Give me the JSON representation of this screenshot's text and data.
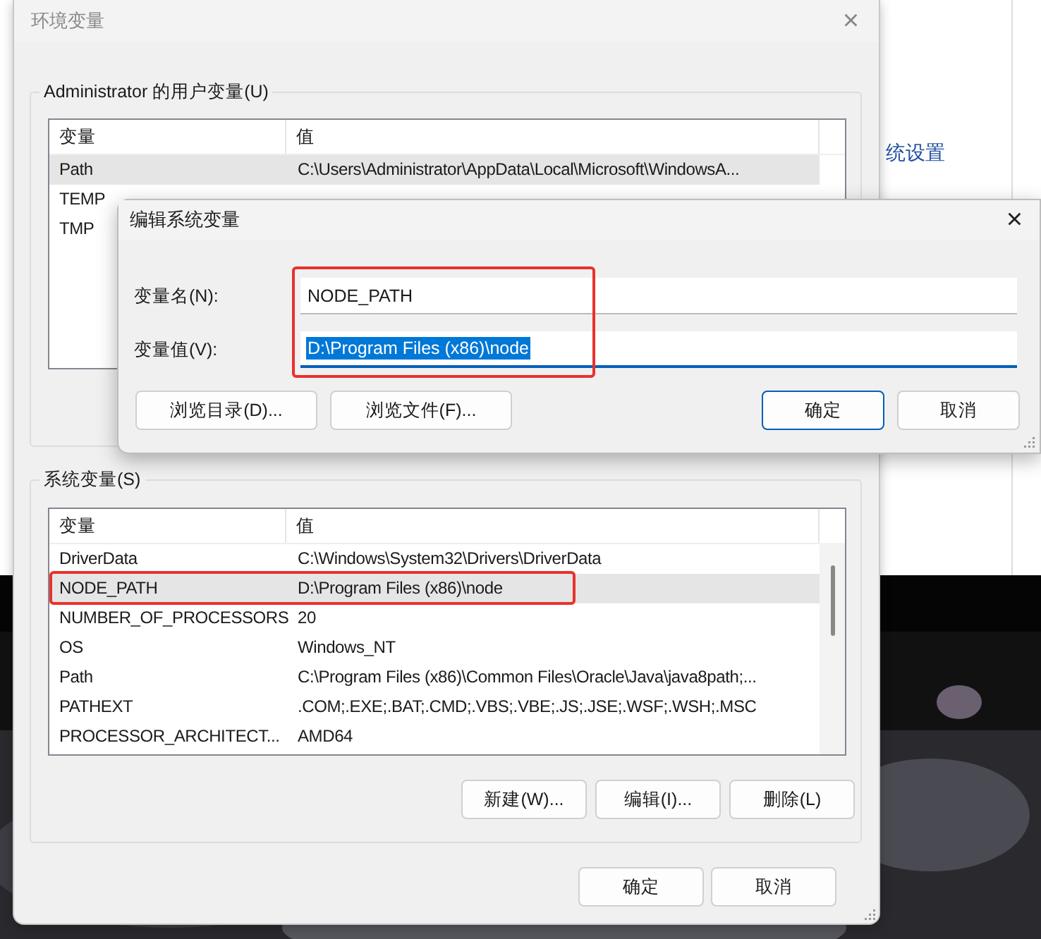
{
  "background_window": {
    "link": "统设置"
  },
  "env_dialog": {
    "title": "环境变量",
    "close": "×",
    "user_vars": {
      "title": "Administrator 的用户变量(U)",
      "columns": [
        "变量",
        "值"
      ],
      "rows": [
        {
          "name": "Path",
          "value": "C:\\Users\\Administrator\\AppData\\Local\\Microsoft\\WindowsA...",
          "selected": true
        },
        {
          "name": "TEMP",
          "selected": false
        },
        {
          "name": "TMP",
          "selected": false
        }
      ]
    },
    "system_vars": {
      "title": "系统变量(S)",
      "columns": [
        "变量",
        "值"
      ],
      "rows": [
        {
          "name": "DriverData",
          "value": "C:\\Windows\\System32\\Drivers\\DriverData",
          "selected": false,
          "annotated": false
        },
        {
          "name": "NODE_PATH",
          "value": "D:\\Program Files (x86)\\node",
          "selected": true,
          "annotated": true
        },
        {
          "name": "NUMBER_OF_PROCESSORS",
          "value": "20",
          "selected": false,
          "annotated": false
        },
        {
          "name": "OS",
          "value": "Windows_NT",
          "selected": false,
          "annotated": false
        },
        {
          "name": "Path",
          "value": "C:\\Program Files (x86)\\Common Files\\Oracle\\Java\\java8path;...",
          "selected": false,
          "annotated": false
        },
        {
          "name": "PATHEXT",
          "value": ".COM;.EXE;.BAT;.CMD;.VBS;.VBE;.JS;.JSE;.WSF;.WSH;.MSC",
          "selected": false,
          "annotated": false
        },
        {
          "name": "PROCESSOR_ARCHITECT...",
          "value": "AMD64",
          "selected": false,
          "annotated": false
        }
      ],
      "buttons": [
        "新建(W)...",
        "编辑(I)...",
        "删除(L)"
      ]
    },
    "buttons": [
      "确定",
      "取消"
    ]
  },
  "edit_dialog": {
    "title": "编辑系统变量",
    "close": "×",
    "annotated": true,
    "fields": [
      {
        "label": "变量名(N):",
        "value": "NODE_PATH",
        "text_selected": false
      },
      {
        "label": "变量值(V):",
        "value": "D:\\Program Files (x86)\\node",
        "text_selected": true
      }
    ],
    "buttons": [
      {
        "label": "浏览目录(D)...",
        "default": false
      },
      {
        "label": "浏览文件(F)...",
        "default": false
      },
      {
        "label": "确定",
        "default": true
      },
      {
        "label": "取消",
        "default": false
      }
    ]
  }
}
